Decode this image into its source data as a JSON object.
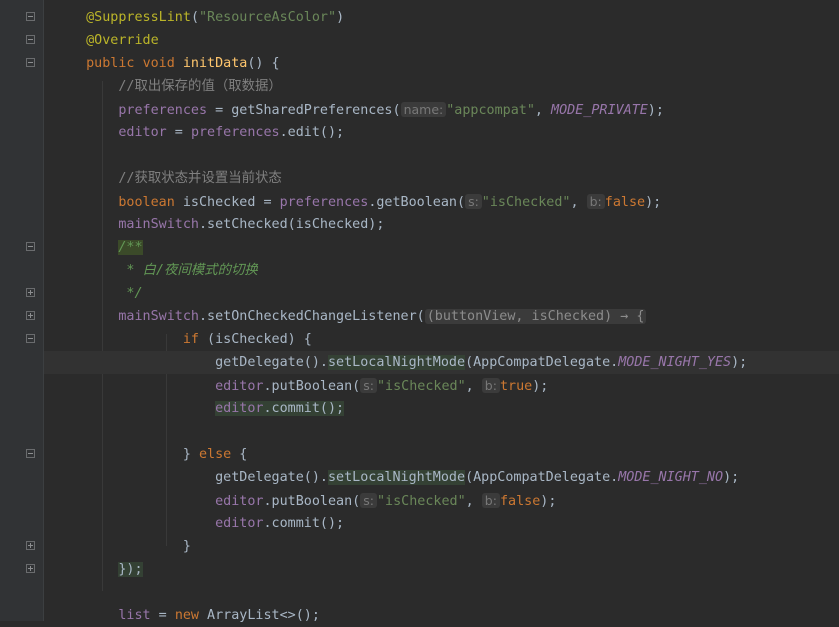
{
  "lines": {
    "l0": {
      "ann": "@SuppressLint",
      "p1": "(",
      "s1": "\"ResourceAsColor\"",
      "p2": ")"
    },
    "l1": {
      "ann": "@Override"
    },
    "l2": {
      "k1": "public",
      "k2": "void",
      "fn": "initData",
      "p": "() {"
    },
    "l3": {
      "cmt": "//取出保存的值（取数据）"
    },
    "l4": {
      "f1": "preferences",
      "p1": " = ",
      "m": "getSharedPreferences(",
      "h": "name:",
      "s": "\"appcompat\"",
      "p2": ", ",
      "c": "MODE_PRIVATE",
      "p3": ");"
    },
    "l5": {
      "f1": "editor",
      "p1": " = ",
      "f2": "preferences",
      "p2": ".edit();"
    },
    "l7": {
      "cmt": "//获取状态并设置当前状态"
    },
    "l8": {
      "k": "boolean",
      "p1": " isChecked = ",
      "f": "preferences",
      "p2": ".getBoolean(",
      "h1": "s:",
      "s": "\"isChecked\"",
      "p3": ", ",
      "h2": "b:",
      "k2": "false",
      "p4": ");"
    },
    "l9": {
      "f": "mainSwitch",
      "p": ".setChecked(isChecked);"
    },
    "l10": {
      "d": "/**"
    },
    "l11": {
      "d": " * 白/夜间模式的切换"
    },
    "l12": {
      "d": " */"
    },
    "l13": {
      "f": "mainSwitch",
      "p1": ".setOnCheckedChangeListener(",
      "lam": "(buttonView, isChecked) → {"
    },
    "l14": {
      "k": "if",
      "p": " (isChecked) {"
    },
    "l15": {
      "p1": "getDelegate().",
      "m": "setLocalNightMode",
      "p2": "(AppCompatDelegate.",
      "c": "MODE_NIGHT_YES",
      "p3": ");"
    },
    "l16": {
      "f": "editor",
      "p1": ".putBoolean(",
      "h1": "s:",
      "s": "\"isChecked\"",
      "p2": ", ",
      "h2": "b:",
      "k": "true",
      "p3": ");"
    },
    "l17": {
      "f": "editor",
      "p": ".commit();"
    },
    "l19": {
      "p1": "} ",
      "k": "else",
      "p2": " {"
    },
    "l20": {
      "p1": "getDelegate().",
      "m": "setLocalNightMode",
      "p2": "(AppCompatDelegate.",
      "c": "MODE_NIGHT_NO",
      "p3": ");"
    },
    "l21": {
      "f": "editor",
      "p1": ".putBoolean(",
      "h1": "s:",
      "s": "\"isChecked\"",
      "p2": ", ",
      "h2": "b:",
      "k": "false",
      "p3": ");"
    },
    "l22": {
      "f": "editor",
      "p": ".commit();"
    },
    "l23": {
      "p": "}"
    },
    "l24": {
      "p": "});"
    },
    "l26": {
      "f": "list",
      "p1": " = ",
      "k": "new",
      "p2": " ArrayList<>();"
    }
  },
  "icons": {
    "fold": "fold-marker-icon",
    "bulb": "lightbulb-icon"
  },
  "colors": {
    "background": "#2b2b2b",
    "keyword": "#cc7832",
    "annotation": "#bbb529",
    "string": "#6a8759",
    "field": "#9876aa",
    "method": "#ffc66d",
    "comment": "#808080",
    "doc": "#629755"
  }
}
